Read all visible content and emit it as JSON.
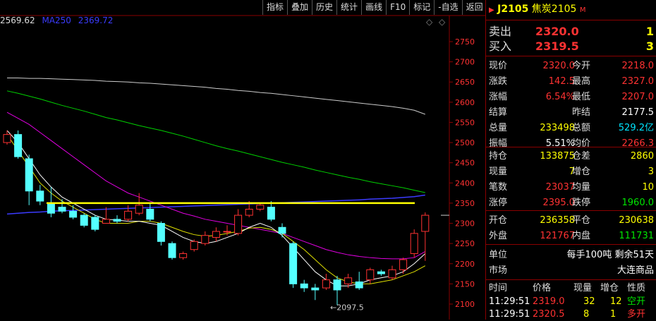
{
  "toolbar": [
    "指标",
    "叠加",
    "历史",
    "统计",
    "画线",
    "F10",
    "标记",
    "-自选",
    "返回"
  ],
  "legend": {
    "ma_a_value": "2569.62",
    "ma250_label": "MA250",
    "ma250_value": "2369.72",
    "ma250_color": "#3b3bff"
  },
  "chart_data": {
    "type": "candlestick",
    "ylim": [
      2085,
      2790
    ],
    "y_ticks": [
      2100,
      2150,
      2200,
      2250,
      2300,
      2350,
      2400,
      2450,
      2500,
      2550,
      2600,
      2650,
      2700,
      2750
    ],
    "candles": [
      {
        "o": 2500,
        "c": 2520,
        "h": 2530,
        "l": 2495
      },
      {
        "o": 2520,
        "c": 2465,
        "h": 2530,
        "l": 2460
      },
      {
        "o": 2460,
        "c": 2380,
        "h": 2470,
        "l": 2345
      },
      {
        "o": 2380,
        "c": 2355,
        "h": 2395,
        "l": 2345
      },
      {
        "o": 2350,
        "c": 2325,
        "h": 2390,
        "l": 2315
      },
      {
        "o": 2340,
        "c": 2330,
        "h": 2360,
        "l": 2325
      },
      {
        "o": 2330,
        "c": 2315,
        "h": 2345,
        "l": 2310
      },
      {
        "o": 2320,
        "c": 2295,
        "h": 2325,
        "l": 2290
      },
      {
        "o": 2315,
        "c": 2285,
        "h": 2320,
        "l": 2280
      },
      {
        "o": 2300,
        "c": 2310,
        "h": 2340,
        "l": 2300
      },
      {
        "o": 2310,
        "c": 2305,
        "h": 2320,
        "l": 2300
      },
      {
        "o": 2310,
        "c": 2330,
        "h": 2345,
        "l": 2305
      },
      {
        "o": 2325,
        "c": 2345,
        "h": 2375,
        "l": 2320
      },
      {
        "o": 2335,
        "c": 2310,
        "h": 2350,
        "l": 2305
      },
      {
        "o": 2300,
        "c": 2255,
        "h": 2305,
        "l": 2245
      },
      {
        "o": 2250,
        "c": 2215,
        "h": 2255,
        "l": 2210
      },
      {
        "o": 2215,
        "c": 2225,
        "h": 2230,
        "l": 2210
      },
      {
        "o": 2235,
        "c": 2255,
        "h": 2260,
        "l": 2230
      },
      {
        "o": 2250,
        "c": 2270,
        "h": 2280,
        "l": 2245
      },
      {
        "o": 2265,
        "c": 2280,
        "h": 2290,
        "l": 2255
      },
      {
        "o": 2280,
        "c": 2280,
        "h": 2295,
        "l": 2270
      },
      {
        "o": 2275,
        "c": 2320,
        "h": 2335,
        "l": 2270
      },
      {
        "o": 2320,
        "c": 2335,
        "h": 2355,
        "l": 2315
      },
      {
        "o": 2335,
        "c": 2345,
        "h": 2350,
        "l": 2330
      },
      {
        "o": 2340,
        "c": 2310,
        "h": 2355,
        "l": 2305
      },
      {
        "o": 2290,
        "c": 2275,
        "h": 2300,
        "l": 2265
      },
      {
        "o": 2250,
        "c": 2150,
        "h": 2255,
        "l": 2140
      },
      {
        "o": 2150,
        "c": 2140,
        "h": 2160,
        "l": 2130
      },
      {
        "o": 2140,
        "c": 2135,
        "h": 2150,
        "l": 2110
      },
      {
        "o": 2140,
        "c": 2160,
        "h": 2175,
        "l": 2135
      },
      {
        "o": 2160,
        "c": 2135,
        "h": 2170,
        "l": 2097.5
      },
      {
        "o": 2150,
        "c": 2165,
        "h": 2175,
        "l": 2140
      },
      {
        "o": 2155,
        "c": 2140,
        "h": 2180,
        "l": 2135
      },
      {
        "o": 2160,
        "c": 2185,
        "h": 2190,
        "l": 2150
      },
      {
        "o": 2180,
        "c": 2175,
        "h": 2185,
        "l": 2170
      },
      {
        "o": 2165,
        "c": 2185,
        "h": 2195,
        "l": 2160
      },
      {
        "o": 2185,
        "c": 2210,
        "h": 2215,
        "l": 2175
      },
      {
        "o": 2225,
        "c": 2275,
        "h": 2285,
        "l": 2215
      },
      {
        "o": 2280,
        "c": 2320,
        "h": 2327,
        "l": 2207
      }
    ],
    "ma_white": [
      2660,
      2660,
      2659,
      2659,
      2658,
      2657,
      2656,
      2655,
      2654,
      2652,
      2651,
      2650,
      2648,
      2647,
      2645,
      2643,
      2641,
      2639,
      2637,
      2634,
      2632,
      2629,
      2627,
      2624,
      2622,
      2619,
      2616,
      2613,
      2610,
      2607,
      2604,
      2601,
      2598,
      2595,
      2592,
      2589,
      2585,
      2580,
      2570
    ],
    "ma_green": [
      2628,
      2622,
      2615,
      2608,
      2600,
      2592,
      2585,
      2578,
      2570,
      2562,
      2556,
      2549,
      2542,
      2536,
      2530,
      2523,
      2516,
      2508,
      2500,
      2492,
      2485,
      2479,
      2472,
      2465,
      2458,
      2451,
      2445,
      2439,
      2432,
      2426,
      2420,
      2414,
      2409,
      2403,
      2398,
      2393,
      2388,
      2382,
      2376
    ],
    "ma250": [
      2323,
      2325,
      2327,
      2328,
      2330,
      2331,
      2332,
      2333,
      2334,
      2335,
      2336,
      2337,
      2338,
      2339,
      2340,
      2341,
      2342,
      2343,
      2344,
      2345,
      2346,
      2347,
      2348,
      2349,
      2350,
      2351,
      2352,
      2353,
      2354,
      2355,
      2356,
      2357,
      2358,
      2360,
      2361,
      2362,
      2364,
      2366,
      2370
    ],
    "ma_magenta": [
      2575,
      2560,
      2545,
      2525,
      2505,
      2485,
      2465,
      2445,
      2425,
      2405,
      2390,
      2375,
      2365,
      2355,
      2345,
      2335,
      2325,
      2318,
      2310,
      2305,
      2300,
      2295,
      2290,
      2285,
      2280,
      2275,
      2265,
      2255,
      2245,
      2235,
      2228,
      2222,
      2218,
      2215,
      2213,
      2212,
      2212,
      2215,
      2230
    ],
    "ma_yellow": [
      2520,
      2480,
      2440,
      2400,
      2375,
      2355,
      2340,
      2325,
      2310,
      2300,
      2300,
      2300,
      2305,
      2305,
      2300,
      2290,
      2280,
      2272,
      2268,
      2270,
      2275,
      2280,
      2288,
      2290,
      2285,
      2275,
      2255,
      2235,
      2210,
      2185,
      2165,
      2155,
      2150,
      2150,
      2155,
      2160,
      2170,
      2180,
      2195
    ],
    "ma_white_thin": [
      2530,
      2500,
      2460,
      2420,
      2390,
      2365,
      2350,
      2335,
      2320,
      2310,
      2308,
      2305,
      2305,
      2300,
      2295,
      2280,
      2265,
      2255,
      2250,
      2255,
      2265,
      2275,
      2290,
      2300,
      2290,
      2270,
      2240,
      2210,
      2180,
      2160,
      2145,
      2145,
      2150,
      2160,
      2165,
      2170,
      2180,
      2200,
      2225
    ],
    "hline_value": 2350,
    "min_label": "2097.5",
    "min_value": 2097.5,
    "min_index": 30
  },
  "quote": {
    "code": "J2105",
    "name": "焦炭2105",
    "badge": "M",
    "sell_label": "卖出",
    "sell_price": "2320.0",
    "sell_vol": "1",
    "buy_label": "买入",
    "buy_price": "2319.5",
    "buy_vol": "3",
    "rows1": [
      {
        "l1": "现价",
        "v1": "2320.0",
        "c1": "red",
        "l2": "今开",
        "v2": "2218.0",
        "c2": "red"
      },
      {
        "l1": "涨跌",
        "v1": "142.5",
        "c1": "red",
        "l2": "最高",
        "v2": "2327.0",
        "c2": "red"
      },
      {
        "l1": "涨幅",
        "v1": "6.54%",
        "c1": "red",
        "l2": "最低",
        "v2": "2207.0",
        "c2": "red"
      },
      {
        "l1": "结算",
        "v1": "",
        "c1": "wht",
        "l2": "昨结",
        "v2": "2177.5",
        "c2": "wht"
      },
      {
        "l1": "总量",
        "v1": "233498",
        "c1": "yel",
        "l2": "总额",
        "v2": "529.2亿",
        "c2": "cyan"
      },
      {
        "l1": "振幅",
        "v1": "5.51%",
        "c1": "wht",
        "l2": "均价",
        "v2": "2266.3",
        "c2": "red"
      }
    ],
    "rows2": [
      {
        "l1": "持仓",
        "v1": "133875",
        "c1": "yel",
        "l2": "仓差",
        "v2": "2860",
        "c2": "yel"
      },
      {
        "l1": "现量",
        "v1": "7",
        "c1": "yel",
        "l2": "增仓",
        "v2": "3",
        "c2": "yel"
      },
      {
        "l1": "笔数",
        "v1": "23037",
        "c1": "red",
        "l2": "均量",
        "v2": "10",
        "c2": "yel"
      },
      {
        "l1": "涨停",
        "v1": "2395.0",
        "c1": "red",
        "l2": "跌停",
        "v2": "1960.0",
        "c2": "grn"
      }
    ],
    "rows3": [
      {
        "l1": "开仓",
        "v1": "236358",
        "c1": "yel",
        "l2": "平仓",
        "v2": "230638",
        "c2": "yel"
      },
      {
        "l1": "外盘",
        "v1": "121767",
        "c1": "red",
        "l2": "内盘",
        "v2": "111731",
        "c2": "grn"
      }
    ],
    "unit_label": "单位",
    "unit_value": "每手100吨  剩余51天",
    "market_label": "市场",
    "market_value": "大连商品",
    "trade_headers": [
      "时间",
      "价格",
      "现量",
      "增仓",
      "性质"
    ],
    "trades": [
      {
        "time": "11:29:51",
        "price": "2319.0",
        "vol": "32",
        "oi": "12",
        "nature": "空开",
        "nc": "grn"
      },
      {
        "time": "11:29:51",
        "price": "2320.5",
        "vol": "8",
        "oi": "1",
        "nature": "多开",
        "nc": "red"
      }
    ]
  }
}
